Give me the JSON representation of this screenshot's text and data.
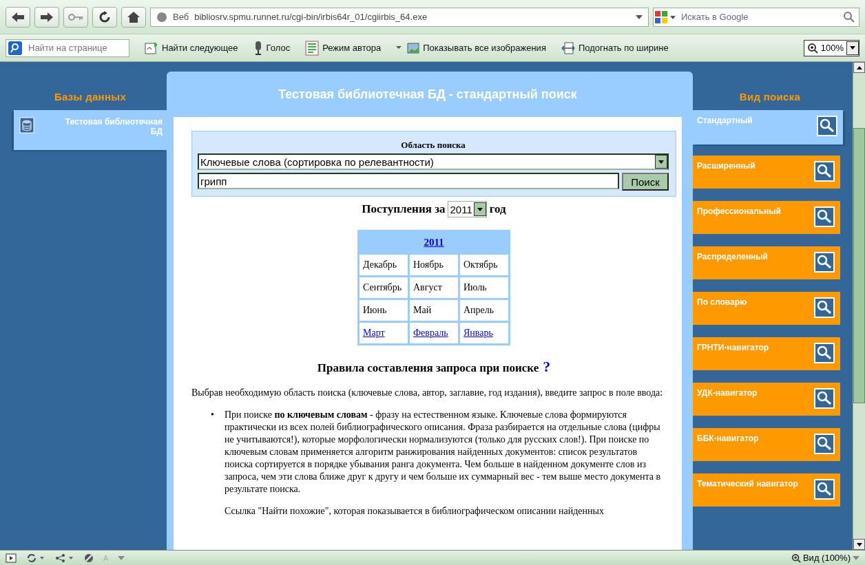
{
  "browser": {
    "address_label": "Веб",
    "address": "bibliosrv.spmu.runnet.ru/cgi-bin/irbis64r_01/cgiirbis_64.exe",
    "search_placeholder": "Искать в Google",
    "find_placeholder": "Найти на странице",
    "toolbar": [
      {
        "kind": "find-next",
        "label": "Найти следующее"
      },
      {
        "kind": "voice",
        "label": "Голос"
      },
      {
        "kind": "author",
        "label": "Режим автора"
      },
      {
        "kind": "images",
        "label": "Показывать все изображения"
      },
      {
        "kind": "fit",
        "label": "Подогнать по ширине"
      }
    ],
    "zoom": "100%"
  },
  "databases": {
    "title": "Базы данных",
    "items": [
      {
        "label": "Тестовая библиотечная БД",
        "selected": true
      }
    ]
  },
  "main": {
    "title": "Тестовая библиотечная БД - стандартный поиск",
    "search": {
      "area_label": "Область поиска",
      "area": "Ключевые слова (сортировка по релевантности)",
      "query": "грипп",
      "button": "Поиск"
    },
    "year_prefix": "Поступления за",
    "year": "2011",
    "year_suffix": "год",
    "calendar": {
      "year": "2011",
      "months": [
        {
          "label": "Декабрь",
          "link": false
        },
        {
          "label": "Ноябрь",
          "link": false
        },
        {
          "label": "Октябрь",
          "link": false
        },
        {
          "label": "Сентябрь",
          "link": false
        },
        {
          "label": "Август",
          "link": false
        },
        {
          "label": "Июль",
          "link": false
        },
        {
          "label": "Июнь",
          "link": false
        },
        {
          "label": "Май",
          "link": false
        },
        {
          "label": "Апрель",
          "link": false
        },
        {
          "label": "Март",
          "link": true
        },
        {
          "label": "Февраль",
          "link": true
        },
        {
          "label": "Январь",
          "link": true
        }
      ]
    },
    "rules_title": "Правила составления запроса при поиске",
    "help": "?",
    "intro": "Выбрав необходимую область поиска (ключевые слова, автор, заглавие, год издания), введите запрос в поле ввода:",
    "bullets": [
      {
        "marker": "•",
        "text": "При поиске **по ключевым словам** - фразу на естественном языке. Ключевые слова формируются практически из всех полей библиографического описания. Фраза разбирается на отдельные слова (цифры не учитываются!), которые морфологически нормализуются (только для русских слов!). При поиске по ключевым словам применяется алгоритм ранжирования найденных документов: список результатов поиска сортируется в порядке убывания ранга документа. Чем больше в найденном документе слов из запроса, чем эти слова ближе друг к другу и чем больше их суммарный вес - тем выше место документа в результате поиска."
      }
    ],
    "note": "Ссылка \"Найти похожие\", которая показывается в библиографическом описании найденных"
  },
  "search_types": {
    "title": "Вид поиска",
    "items": [
      {
        "label": "Стандартный",
        "selected": true
      },
      {
        "label": "Расширенный",
        "selected": false
      },
      {
        "label": "Профессиональный",
        "selected": false
      },
      {
        "label": "Распределенный",
        "selected": false
      },
      {
        "label": "По словарю",
        "selected": false
      },
      {
        "label": "ГРНТИ-навигатор",
        "selected": false
      },
      {
        "label": "УДК-навигатор",
        "selected": false
      },
      {
        "label": "ББК-навигатор",
        "selected": false
      },
      {
        "label": "Тематический навигатор",
        "selected": false
      }
    ]
  },
  "status_bar": {
    "indicator": "A",
    "zoom": "Вид (100%)"
  }
}
